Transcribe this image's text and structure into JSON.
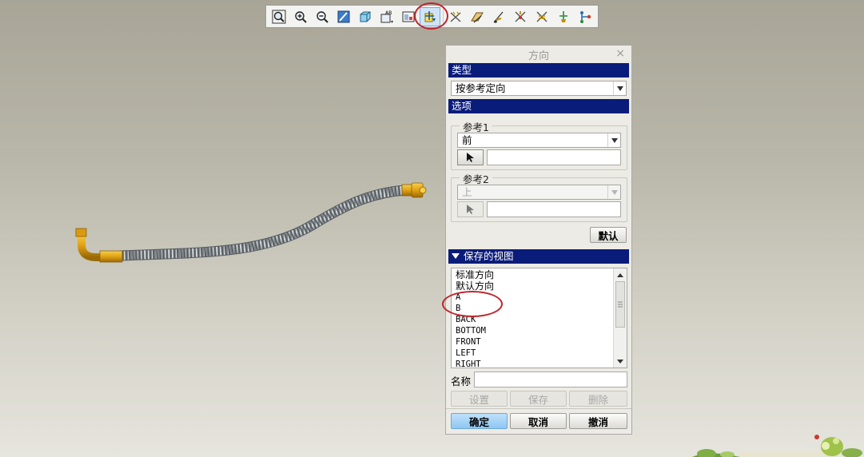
{
  "toolbar": {
    "icons": [
      "zoom-fit-icon",
      "zoom-in-icon",
      "zoom-out-icon",
      "repaint-icon",
      "shading-icon",
      "saved-views-icon",
      "view-manager-icon",
      "reorient-icon",
      "datum-planes-icon",
      "datum-axes-icon",
      "datum-points-icon",
      "csys-icon",
      "display-toggle-icon",
      "annotation-icon",
      "spin-center-icon"
    ],
    "active_icon": "reorient-icon"
  },
  "dialog": {
    "title": "方向",
    "close_glyph": "×",
    "type_section": "类型",
    "type_value": "按参考定向",
    "options_section": "选项",
    "ref1": {
      "legend": "参考1",
      "value": "前"
    },
    "ref2": {
      "legend": "参考2",
      "value": "上"
    },
    "default_button": "默认",
    "saved_section": "保存的视图",
    "saved_views": [
      "标准方向",
      "默认方向",
      "A",
      "B",
      "BACK",
      "BOTTOM",
      "FRONT",
      "LEFT",
      "RIGHT"
    ],
    "name_label": "名称",
    "name_value": "",
    "set_button": "设置",
    "save_button": "保存",
    "delete_button": "删除",
    "ok_button": "确定",
    "cancel_button": "取消",
    "undo_button": "撤消"
  },
  "colors": {
    "section_header": "#0a1c7a",
    "highlight_ring": "#c0242b",
    "ok_button": "#8ec7f2",
    "fitting": "#e0a216"
  }
}
